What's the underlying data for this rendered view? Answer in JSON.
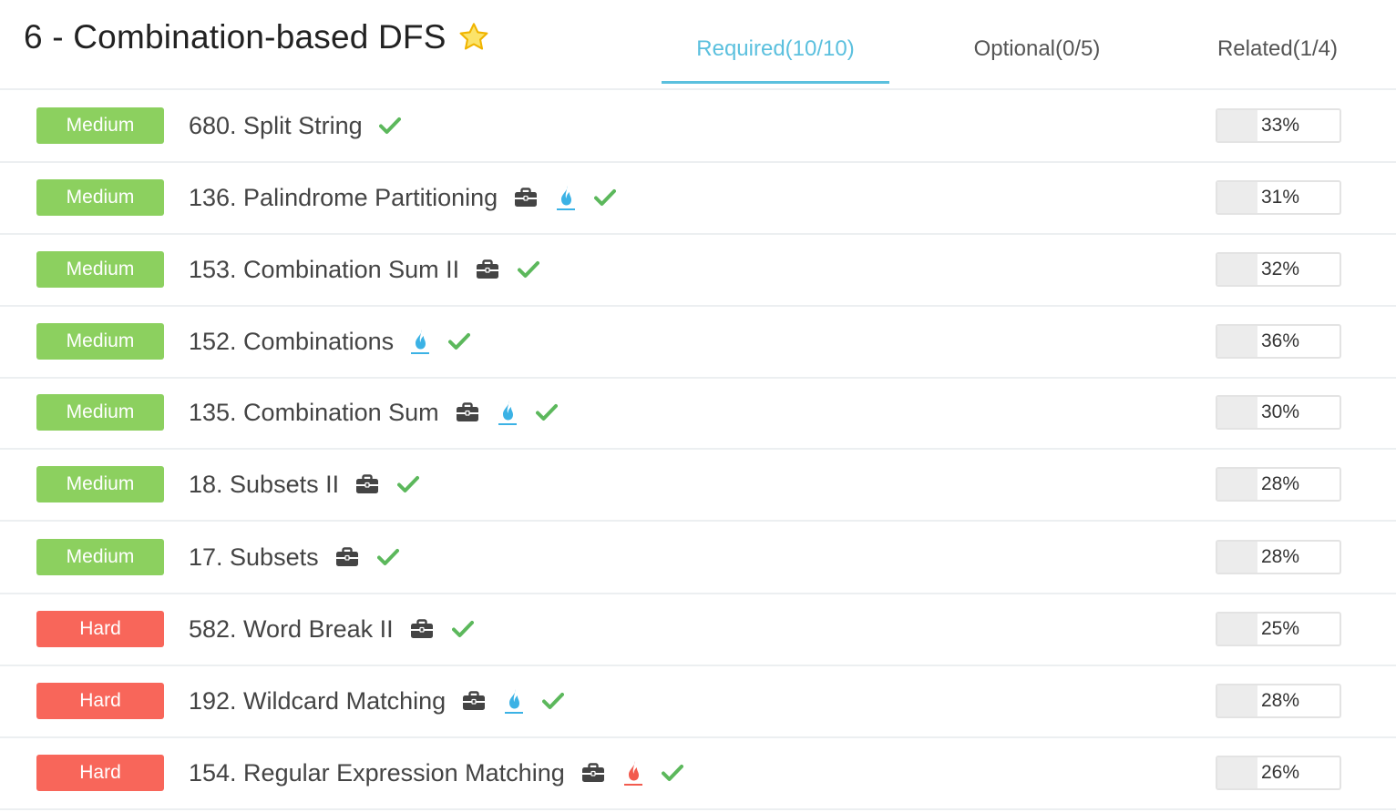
{
  "header": {
    "title": "6 - Combination-based DFS",
    "tabs": [
      {
        "label": "Required(10/10)",
        "active": true
      },
      {
        "label": "Optional(0/5)",
        "active": false
      },
      {
        "label": "Related(1/4)",
        "active": false
      }
    ]
  },
  "colors": {
    "accent": "#5bc0de",
    "medium": "#8cd05f",
    "hard": "#f8665a",
    "check": "#5cb85c",
    "briefcase": "#444444",
    "flame_blue": "#3bb2e5",
    "flame_red": "#f25b4e",
    "star": "#f7d22e"
  },
  "problems": [
    {
      "difficulty": "Medium",
      "title": "680. Split String",
      "icons": [
        "check-icon"
      ],
      "acceptance": "33%"
    },
    {
      "difficulty": "Medium",
      "title": "136. Palindrome Partitioning",
      "icons": [
        "briefcase-icon",
        "flame-blue-icon",
        "check-icon"
      ],
      "acceptance": "31%"
    },
    {
      "difficulty": "Medium",
      "title": "153. Combination Sum II",
      "icons": [
        "briefcase-icon",
        "check-icon"
      ],
      "acceptance": "32%"
    },
    {
      "difficulty": "Medium",
      "title": "152. Combinations",
      "icons": [
        "flame-blue-icon",
        "check-icon"
      ],
      "acceptance": "36%"
    },
    {
      "difficulty": "Medium",
      "title": "135. Combination Sum",
      "icons": [
        "briefcase-icon",
        "flame-blue-icon",
        "check-icon"
      ],
      "acceptance": "30%"
    },
    {
      "difficulty": "Medium",
      "title": "18. Subsets II",
      "icons": [
        "briefcase-icon",
        "check-icon"
      ],
      "acceptance": "28%"
    },
    {
      "difficulty": "Medium",
      "title": "17. Subsets",
      "icons": [
        "briefcase-icon",
        "check-icon"
      ],
      "acceptance": "28%"
    },
    {
      "difficulty": "Hard",
      "title": "582. Word Break II",
      "icons": [
        "briefcase-icon",
        "check-icon"
      ],
      "acceptance": "25%"
    },
    {
      "difficulty": "Hard",
      "title": "192. Wildcard Matching",
      "icons": [
        "briefcase-icon",
        "flame-blue-icon",
        "check-icon"
      ],
      "acceptance": "28%"
    },
    {
      "difficulty": "Hard",
      "title": "154. Regular Expression Matching",
      "icons": [
        "briefcase-icon",
        "flame-red-icon",
        "check-icon"
      ],
      "acceptance": "26%"
    }
  ]
}
